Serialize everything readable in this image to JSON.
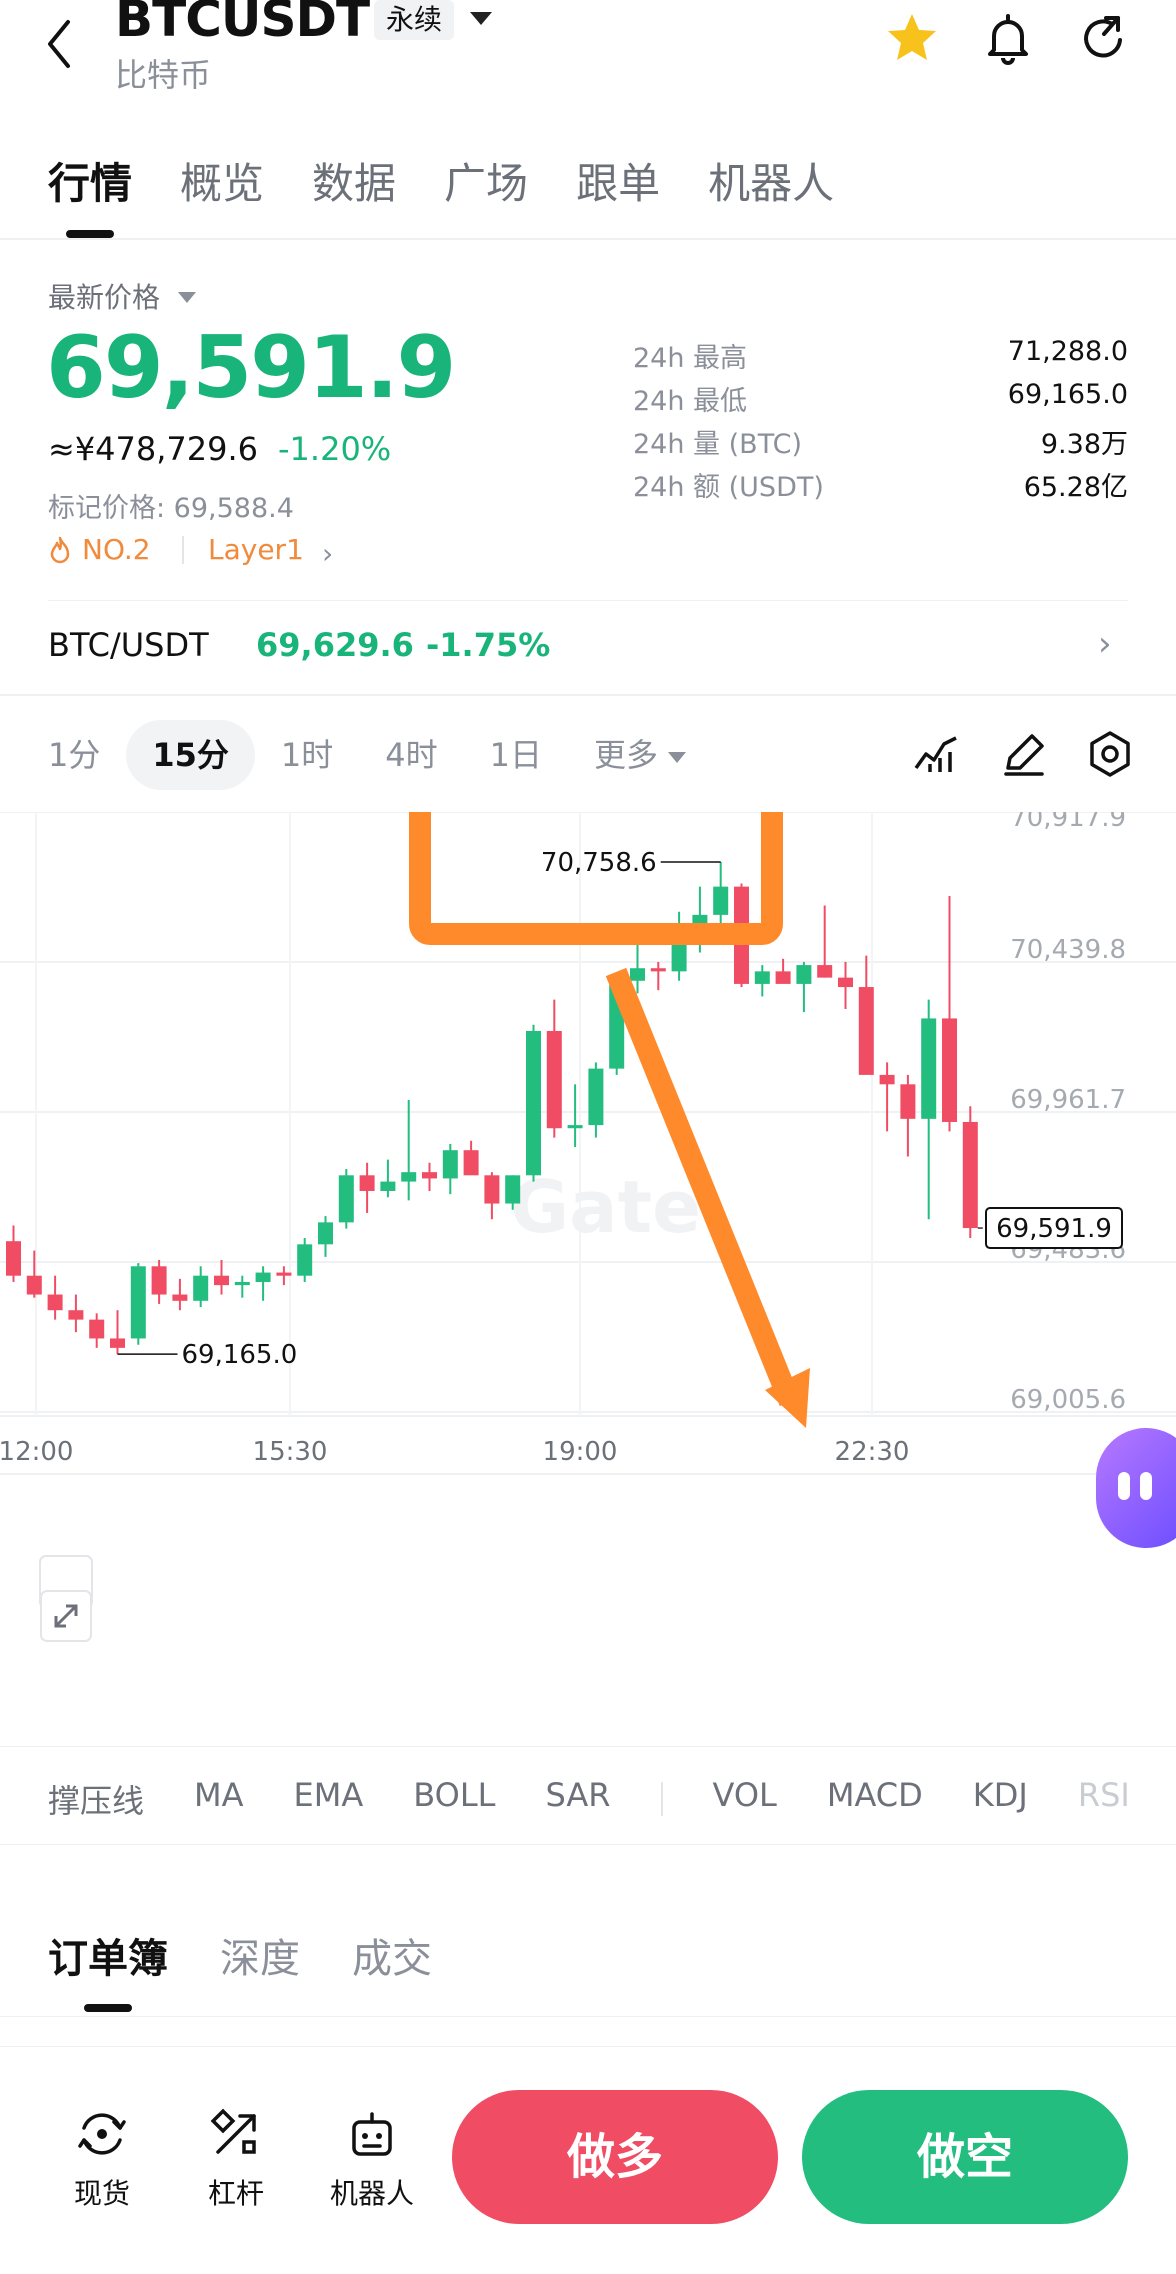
{
  "header": {
    "symbol": "BTCUSDT",
    "contract_type": "永续",
    "name": "比特币",
    "icons": [
      "back-arrow-icon",
      "star-icon",
      "bell-icon",
      "share-icon"
    ]
  },
  "tabs": [
    "行情",
    "概览",
    "数据",
    "广场",
    "跟单",
    "机器人"
  ],
  "price": {
    "latest_label": "最新价格",
    "last": "69,591.9",
    "cny": "≈¥478,729.6",
    "change_pct": "-1.20%",
    "mark_price": "标记价格: 69,588.4",
    "rank": "NO.2",
    "tag": "Layer1"
  },
  "stats": [
    {
      "label": "24h  最高",
      "value": "71,288.0"
    },
    {
      "label": "24h  最低",
      "value": "69,165.0"
    },
    {
      "label": "24h  量 (BTC)",
      "value": "9.38万"
    },
    {
      "label": "24h  额 (USDT)",
      "value": "65.28亿"
    }
  ],
  "pair": {
    "name": "BTC/USDT",
    "price": "69,629.6",
    "change": "-1.75%"
  },
  "intervals": [
    "1分",
    "15分",
    "1时",
    "4时",
    "1日",
    "更多"
  ],
  "active_interval": "15分",
  "chart_tools": [
    "indicator-icon",
    "draw-icon",
    "settings-icon"
  ],
  "chart_data": {
    "type": "candlestick",
    "y_ticks": [
      "70,917.9",
      "70,439.8",
      "69,961.7",
      "69,483.6",
      "69,005.6"
    ],
    "x_ticks": [
      "12:00",
      "15:30",
      "19:00",
      "22:30"
    ],
    "ylim": [
      69005.6,
      70917.9
    ],
    "high_label": "70,758.6",
    "low_label": "69,165.0",
    "last_price_label": "69,591.9",
    "colors": {
      "up": "#23bd7f",
      "down": "#f04c63"
    },
    "candles": [
      [
        69550,
        69600,
        69420,
        69440
      ],
      [
        69440,
        69520,
        69370,
        69380
      ],
      [
        69380,
        69440,
        69300,
        69330
      ],
      [
        69330,
        69380,
        69260,
        69300
      ],
      [
        69300,
        69320,
        69210,
        69240
      ],
      [
        69240,
        69330,
        69190,
        69210
      ],
      [
        69240,
        69480,
        69220,
        69470
      ],
      [
        69470,
        69490,
        69350,
        69380
      ],
      [
        69380,
        69430,
        69330,
        69360
      ],
      [
        69360,
        69470,
        69340,
        69440
      ],
      [
        69440,
        69490,
        69380,
        69410
      ],
      [
        69410,
        69440,
        69370,
        69420
      ],
      [
        69420,
        69470,
        69360,
        69450
      ],
      [
        69450,
        69470,
        69410,
        69440
      ],
      [
        69440,
        69560,
        69420,
        69540
      ],
      [
        69540,
        69630,
        69500,
        69610
      ],
      [
        69610,
        69780,
        69590,
        69760
      ],
      [
        69760,
        69800,
        69640,
        69710
      ],
      [
        69710,
        69810,
        69690,
        69740
      ],
      [
        69740,
        70000,
        69680,
        69770
      ],
      [
        69770,
        69800,
        69710,
        69750
      ],
      [
        69750,
        69860,
        69700,
        69840
      ],
      [
        69840,
        69870,
        69770,
        69760
      ],
      [
        69760,
        69770,
        69620,
        69670
      ],
      [
        69670,
        69760,
        69650,
        69760
      ],
      [
        69760,
        70240,
        69740,
        70220
      ],
      [
        70220,
        70320,
        69880,
        69910
      ],
      [
        69910,
        70050,
        69850,
        69920
      ],
      [
        69920,
        70120,
        69880,
        70100
      ],
      [
        70100,
        70400,
        70080,
        70380
      ],
      [
        70380,
        70510,
        70340,
        70420
      ],
      [
        70420,
        70440,
        70350,
        70410
      ],
      [
        70410,
        70600,
        70380,
        70510
      ],
      [
        70510,
        70680,
        70470,
        70590
      ],
      [
        70590,
        70758.6,
        70500,
        70680
      ],
      [
        70680,
        70690,
        70360,
        70370
      ],
      [
        70370,
        70430,
        70330,
        70410
      ],
      [
        70410,
        70450,
        70380,
        70370
      ],
      [
        70370,
        70440,
        70280,
        70430
      ],
      [
        70430,
        70620,
        70390,
        70390
      ],
      [
        70390,
        70440,
        70290,
        70360
      ],
      [
        70360,
        70460,
        70330,
        70080
      ],
      [
        70080,
        70120,
        69900,
        70050
      ],
      [
        70050,
        70080,
        69820,
        69940
      ],
      [
        69940,
        70320,
        69620,
        70260
      ],
      [
        70260,
        70650,
        69900,
        69930
      ],
      [
        69930,
        69980,
        69560,
        69591.9
      ]
    ]
  },
  "annotations": {
    "highlight_box_color": "#ff8a2b",
    "arrow_color": "#ff8a2b"
  },
  "indicators": [
    "撑压线",
    "MA",
    "EMA",
    "BOLL",
    "SAR",
    "VOL",
    "MACD",
    "KDJ",
    "RSI"
  ],
  "orderbook_tabs": [
    "订单簿",
    "深度",
    "成交"
  ],
  "bottom_bar": {
    "spot": "现货",
    "margin": "杠杆",
    "bot": "机器人",
    "long": "做多",
    "short": "做空"
  }
}
